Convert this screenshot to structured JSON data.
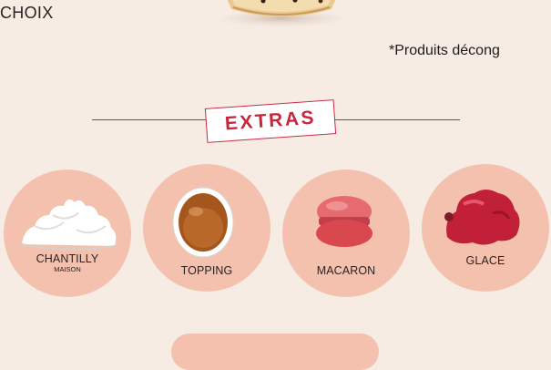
{
  "header": {
    "choix_text": "CHOIX",
    "note_text": "*Produits décong"
  },
  "extras": {
    "title": "EXTRAS",
    "items": [
      {
        "label": "CHANTILLY",
        "sublabel": "MAISON",
        "icon": "whipped-cream-icon"
      },
      {
        "label": "TOPPING",
        "icon": "caramel-topping-cup-icon"
      },
      {
        "label": "MACARON",
        "icon": "macaron-icon"
      },
      {
        "label": "GLACE",
        "icon": "ice-cream-scoop-icon"
      }
    ]
  },
  "colors": {
    "background": "#f6ece4",
    "accent_red": "#c8263e",
    "circle_peach": "#f4c1ae",
    "text_dark": "#2a2324"
  }
}
